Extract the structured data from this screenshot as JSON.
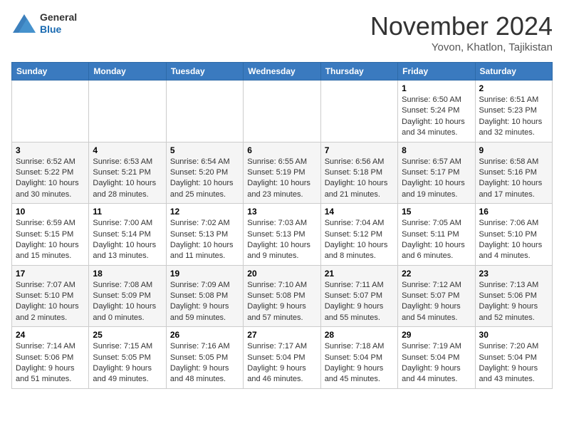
{
  "header": {
    "logo_general": "General",
    "logo_blue": "Blue",
    "month_title": "November 2024",
    "location": "Yovon, Khatlon, Tajikistan"
  },
  "days_of_week": [
    "Sunday",
    "Monday",
    "Tuesday",
    "Wednesday",
    "Thursday",
    "Friday",
    "Saturday"
  ],
  "weeks": [
    [
      {
        "day": "",
        "info": ""
      },
      {
        "day": "",
        "info": ""
      },
      {
        "day": "",
        "info": ""
      },
      {
        "day": "",
        "info": ""
      },
      {
        "day": "",
        "info": ""
      },
      {
        "day": "1",
        "info": "Sunrise: 6:50 AM\nSunset: 5:24 PM\nDaylight: 10 hours and 34 minutes."
      },
      {
        "day": "2",
        "info": "Sunrise: 6:51 AM\nSunset: 5:23 PM\nDaylight: 10 hours and 32 minutes."
      }
    ],
    [
      {
        "day": "3",
        "info": "Sunrise: 6:52 AM\nSunset: 5:22 PM\nDaylight: 10 hours and 30 minutes."
      },
      {
        "day": "4",
        "info": "Sunrise: 6:53 AM\nSunset: 5:21 PM\nDaylight: 10 hours and 28 minutes."
      },
      {
        "day": "5",
        "info": "Sunrise: 6:54 AM\nSunset: 5:20 PM\nDaylight: 10 hours and 25 minutes."
      },
      {
        "day": "6",
        "info": "Sunrise: 6:55 AM\nSunset: 5:19 PM\nDaylight: 10 hours and 23 minutes."
      },
      {
        "day": "7",
        "info": "Sunrise: 6:56 AM\nSunset: 5:18 PM\nDaylight: 10 hours and 21 minutes."
      },
      {
        "day": "8",
        "info": "Sunrise: 6:57 AM\nSunset: 5:17 PM\nDaylight: 10 hours and 19 minutes."
      },
      {
        "day": "9",
        "info": "Sunrise: 6:58 AM\nSunset: 5:16 PM\nDaylight: 10 hours and 17 minutes."
      }
    ],
    [
      {
        "day": "10",
        "info": "Sunrise: 6:59 AM\nSunset: 5:15 PM\nDaylight: 10 hours and 15 minutes."
      },
      {
        "day": "11",
        "info": "Sunrise: 7:00 AM\nSunset: 5:14 PM\nDaylight: 10 hours and 13 minutes."
      },
      {
        "day": "12",
        "info": "Sunrise: 7:02 AM\nSunset: 5:13 PM\nDaylight: 10 hours and 11 minutes."
      },
      {
        "day": "13",
        "info": "Sunrise: 7:03 AM\nSunset: 5:13 PM\nDaylight: 10 hours and 9 minutes."
      },
      {
        "day": "14",
        "info": "Sunrise: 7:04 AM\nSunset: 5:12 PM\nDaylight: 10 hours and 8 minutes."
      },
      {
        "day": "15",
        "info": "Sunrise: 7:05 AM\nSunset: 5:11 PM\nDaylight: 10 hours and 6 minutes."
      },
      {
        "day": "16",
        "info": "Sunrise: 7:06 AM\nSunset: 5:10 PM\nDaylight: 10 hours and 4 minutes."
      }
    ],
    [
      {
        "day": "17",
        "info": "Sunrise: 7:07 AM\nSunset: 5:10 PM\nDaylight: 10 hours and 2 minutes."
      },
      {
        "day": "18",
        "info": "Sunrise: 7:08 AM\nSunset: 5:09 PM\nDaylight: 10 hours and 0 minutes."
      },
      {
        "day": "19",
        "info": "Sunrise: 7:09 AM\nSunset: 5:08 PM\nDaylight: 9 hours and 59 minutes."
      },
      {
        "day": "20",
        "info": "Sunrise: 7:10 AM\nSunset: 5:08 PM\nDaylight: 9 hours and 57 minutes."
      },
      {
        "day": "21",
        "info": "Sunrise: 7:11 AM\nSunset: 5:07 PM\nDaylight: 9 hours and 55 minutes."
      },
      {
        "day": "22",
        "info": "Sunrise: 7:12 AM\nSunset: 5:07 PM\nDaylight: 9 hours and 54 minutes."
      },
      {
        "day": "23",
        "info": "Sunrise: 7:13 AM\nSunset: 5:06 PM\nDaylight: 9 hours and 52 minutes."
      }
    ],
    [
      {
        "day": "24",
        "info": "Sunrise: 7:14 AM\nSunset: 5:06 PM\nDaylight: 9 hours and 51 minutes."
      },
      {
        "day": "25",
        "info": "Sunrise: 7:15 AM\nSunset: 5:05 PM\nDaylight: 9 hours and 49 minutes."
      },
      {
        "day": "26",
        "info": "Sunrise: 7:16 AM\nSunset: 5:05 PM\nDaylight: 9 hours and 48 minutes."
      },
      {
        "day": "27",
        "info": "Sunrise: 7:17 AM\nSunset: 5:04 PM\nDaylight: 9 hours and 46 minutes."
      },
      {
        "day": "28",
        "info": "Sunrise: 7:18 AM\nSunset: 5:04 PM\nDaylight: 9 hours and 45 minutes."
      },
      {
        "day": "29",
        "info": "Sunrise: 7:19 AM\nSunset: 5:04 PM\nDaylight: 9 hours and 44 minutes."
      },
      {
        "day": "30",
        "info": "Sunrise: 7:20 AM\nSunset: 5:04 PM\nDaylight: 9 hours and 43 minutes."
      }
    ]
  ]
}
